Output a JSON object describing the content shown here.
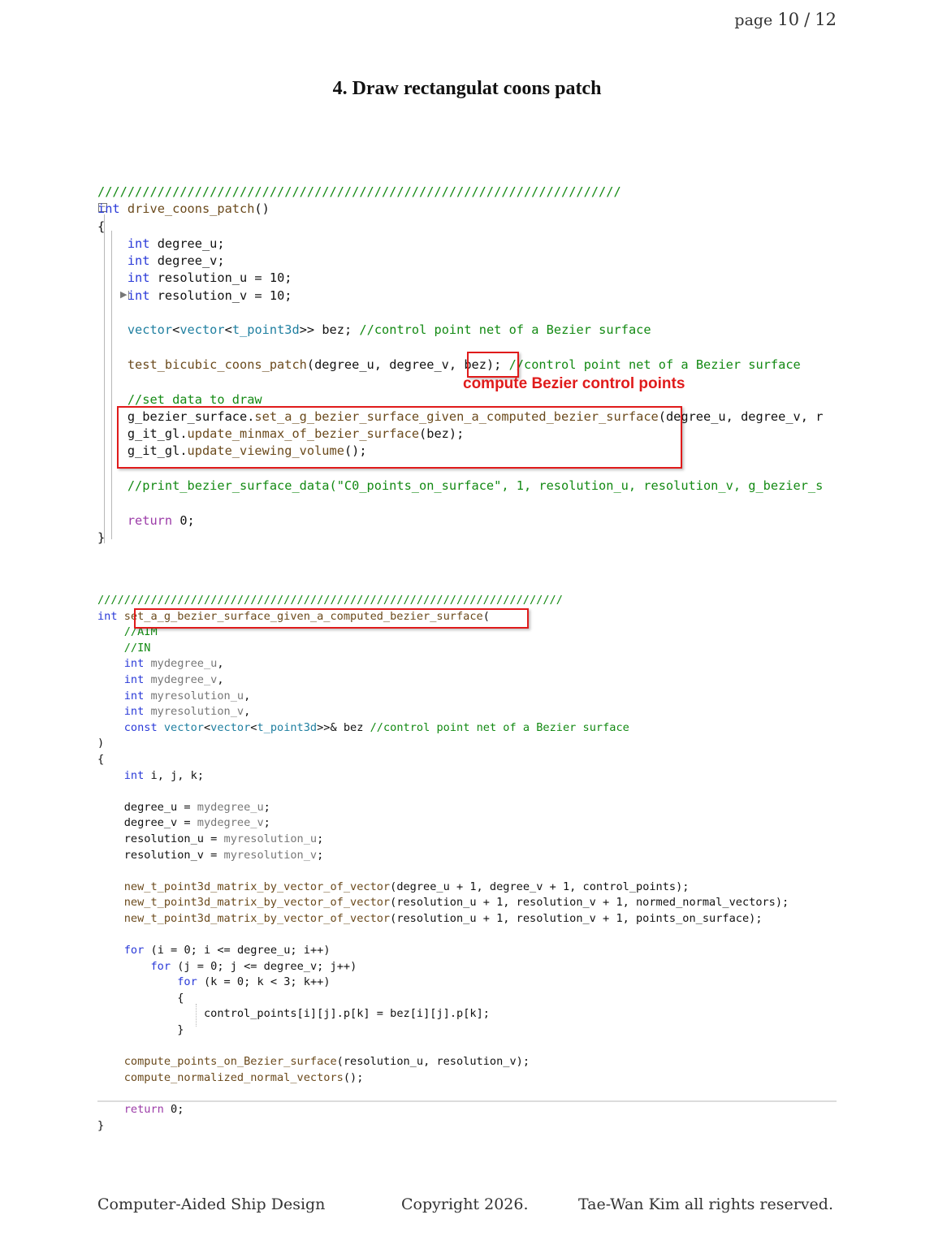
{
  "header": {
    "page_label": "page",
    "page_current": "10",
    "page_sep": "/",
    "page_total": "12"
  },
  "title": "4.  Draw rectangulat coons patch",
  "code1": {
    "slashes": "//////////////////////////////////////////////////////////////////////",
    "lines": [
      "int drive_coons_patch()",
      "{",
      "    int degree_u;",
      "    int degree_v;",
      "    int resolution_u = 10;",
      "    int resolution_v = 10;",
      "",
      "    vector<vector<t_point3d>> bez; //control point net of a Bezier surface",
      "",
      "    test_bicubic_coons_patch(degree_u, degree_v, bez); //control point net of a Bezier surface",
      "",
      "    //set data to draw",
      "    g_bezier_surface.set_a_g_bezier_surface_given_a_computed_bezier_surface(degree_u, degree_v, r",
      "    g_it_gl.update_minmax_of_bezier_surface(bez);",
      "    g_it_gl.update_viewing_volume();",
      "",
      "    //print_bezier_surface_data(\"C0_points_on_surface\", 1, resolution_u, resolution_v, g_bezier_s",
      "",
      "    return 0;",
      "}"
    ]
  },
  "annotation": "compute Bezier control points",
  "code2": {
    "slashes": "//////////////////////////////////////////////////////////////////////",
    "lines": [
      "int set_a_g_bezier_surface_given_a_computed_bezier_surface(",
      "    //AIM",
      "    //IN",
      "    int mydegree_u,",
      "    int mydegree_v,",
      "    int myresolution_u,",
      "    int myresolution_v,",
      "    const vector<vector<t_point3d>>& bez //control point net of a Bezier surface",
      ")",
      "{",
      "    int i, j, k;",
      "",
      "    degree_u = mydegree_u;",
      "    degree_v = mydegree_v;",
      "    resolution_u = myresolution_u;",
      "    resolution_v = myresolution_v;",
      "",
      "    new_t_point3d_matrix_by_vector_of_vector(degree_u + 1, degree_v + 1, control_points);",
      "    new_t_point3d_matrix_by_vector_of_vector(resolution_u + 1, resolution_v + 1, normed_normal_vectors);",
      "    new_t_point3d_matrix_by_vector_of_vector(resolution_u + 1, resolution_v + 1, points_on_surface);",
      "",
      "    for (i = 0; i <= degree_u; i++)",
      "        for (j = 0; j <= degree_v; j++)",
      "            for (k = 0; k < 3; k++)",
      "            {",
      "                control_points[i][j].p[k] = bez[i][j].p[k];",
      "            }",
      "",
      "    compute_points_on_Bezier_surface(resolution_u, resolution_v);",
      "    compute_normalized_normal_vectors();",
      "",
      "    return 0;",
      "}"
    ]
  },
  "footer": {
    "course": "Computer-Aided Ship Design",
    "copyright": "Copyright 2026.",
    "author": "Tae-Wan Kim all rights reserved."
  },
  "colors": {
    "highlight_box": "#e01b1b",
    "comment": "#138a13",
    "keyword": "#2a3ad8"
  }
}
